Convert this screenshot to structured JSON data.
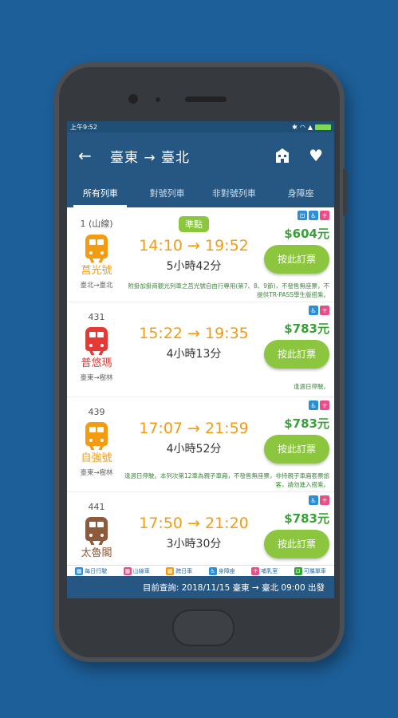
{
  "status": {
    "time": "上午9:52"
  },
  "header": {
    "title": "臺東 → 臺北",
    "hotel_icon_label": "HOTEL"
  },
  "tabs": [
    "所有列車",
    "對號列車",
    "非對號列車",
    "身障座"
  ],
  "trains": [
    {
      "number": "1 (山線)",
      "type": "莒光號",
      "route": "臺北→臺北",
      "badge": "準點",
      "times": "14:10 → 19:52",
      "duration": "5小時42分",
      "price": "$604元",
      "book_label": "按此訂票",
      "note": "附掛加掛商觀光列車之莒光號自由行專用(第7、8、9節)，不發售無座票，不提供TR-PASS學生版搭乘。",
      "color": "#f39c12"
    },
    {
      "number": "431",
      "type": "普悠瑪",
      "route": "臺東→樹林",
      "badge": "",
      "times": "15:22 → 19:35",
      "duration": "4小時13分",
      "price": "$783元",
      "book_label": "按此訂票",
      "note": "逢週日停駛。",
      "color": "#e53935"
    },
    {
      "number": "439",
      "type": "自強號",
      "route": "臺東→樹林",
      "badge": "",
      "times": "17:07 → 21:59",
      "duration": "4小時52分",
      "price": "$783元",
      "book_label": "按此訂票",
      "note": "逢週日停駛。本列次第12車為親子車廂，不發售無座票，非持親子車廂套票旅客，請勿進入搭乘。",
      "color": "#f39c12"
    },
    {
      "number": "441",
      "type": "太魯閣",
      "route": "",
      "badge": "",
      "times": "17:50 → 21:20",
      "duration": "3小時30分",
      "price": "$783元",
      "book_label": "按此訂票",
      "note": "",
      "color": "#8d5a3c"
    }
  ],
  "legend": [
    "每日行駛",
    "山線車",
    "跨日車",
    "身障座",
    "哺乳室",
    "可攜單車"
  ],
  "footer": {
    "query": "目前查詢: 2018/11/15 臺東 → 臺北 09:00 出發"
  },
  "colors": {
    "primary": "#255782",
    "accent_green": "#8cc63f",
    "time_orange": "#f39c12",
    "price_green": "#38a137"
  }
}
